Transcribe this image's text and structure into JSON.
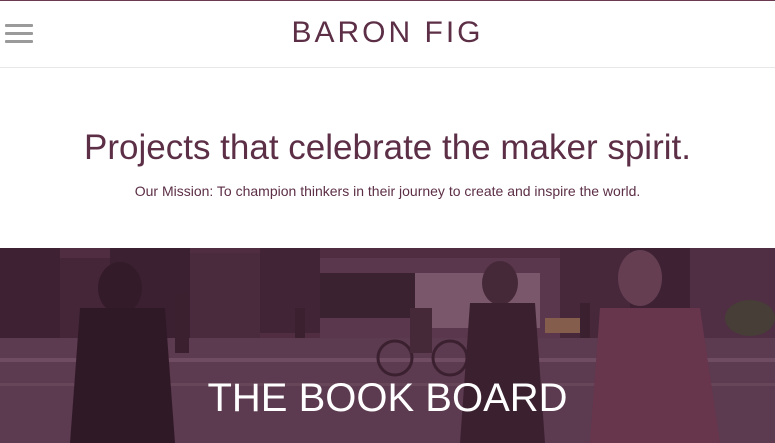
{
  "header": {
    "menu_icon": "hamburger-menu-icon",
    "logo_text": "BARON FIG"
  },
  "mission": {
    "headline": "Projects that celebrate the maker spirit.",
    "subline": "Our Mission: To champion thinkers in their journey to create and inspire the world."
  },
  "hero": {
    "title": "THE BOOK BOARD",
    "overlay_color": "#5c2846"
  },
  "colors": {
    "brand": "#5c2f47",
    "menu_icon": "#9a9a9a"
  }
}
